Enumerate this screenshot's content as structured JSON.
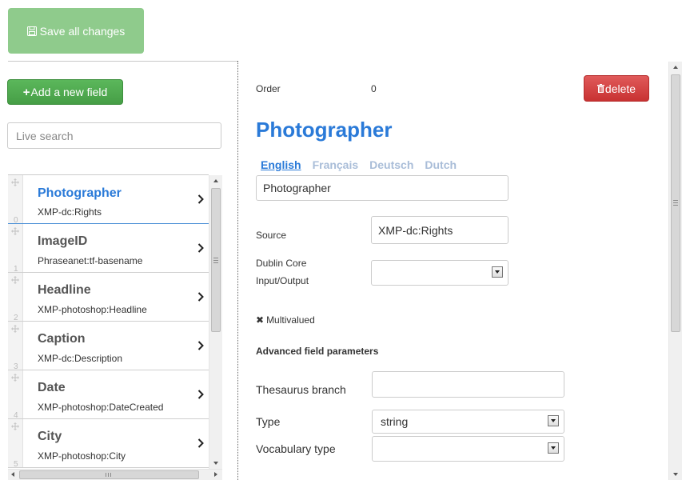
{
  "toolbar": {
    "save_label": "Save all changes"
  },
  "sidebar": {
    "add_field_label": "Add a new field",
    "search_placeholder": "Live search",
    "fields": [
      {
        "name": "Photographer",
        "source": "XMP-dc:Rights",
        "order": "0"
      },
      {
        "name": "ImageID",
        "source": "Phraseanet:tf-basename",
        "order": "1"
      },
      {
        "name": "Headline",
        "source": "XMP-photoshop:Headline",
        "order": "2"
      },
      {
        "name": "Caption",
        "source": "XMP-dc:Description",
        "order": "3"
      },
      {
        "name": "Date",
        "source": "XMP-photoshop:DateCreated",
        "order": "4"
      },
      {
        "name": "City",
        "source": "XMP-photoshop:City",
        "order": "5"
      }
    ]
  },
  "detail": {
    "order_label": "Order",
    "order_value": "0",
    "delete_label": "delete",
    "title": "Photographer",
    "languages": [
      "English",
      "Français",
      "Deutsch",
      "Dutch"
    ],
    "active_language": "English",
    "label_value": "Photographer",
    "source_label": "Source",
    "source_value": "XMP-dc:Rights",
    "dublin_core_label_line1": "Dublin Core",
    "dublin_core_label_line2": "Input/Output",
    "dublin_core_value": "",
    "multivalued_label": "Multivalued",
    "advanced_label": "Advanced field parameters",
    "thesaurus_label": "Thesaurus branch",
    "thesaurus_value": "",
    "type_label": "Type",
    "type_value": "string",
    "vocabulary_label": "Vocabulary type",
    "vocabulary_value": ""
  },
  "colors": {
    "accent_blue": "#2a7ad8",
    "save_green_disabled": "#8fcb8c",
    "add_green": "#5bb75b",
    "delete_red": "#d84444"
  },
  "icons": {
    "save": "floppy-disk-icon",
    "add": "plus-icon",
    "delete": "trash-icon",
    "drag": "move-icon",
    "open": "chevron-right-icon",
    "multivalued": "x-icon"
  }
}
